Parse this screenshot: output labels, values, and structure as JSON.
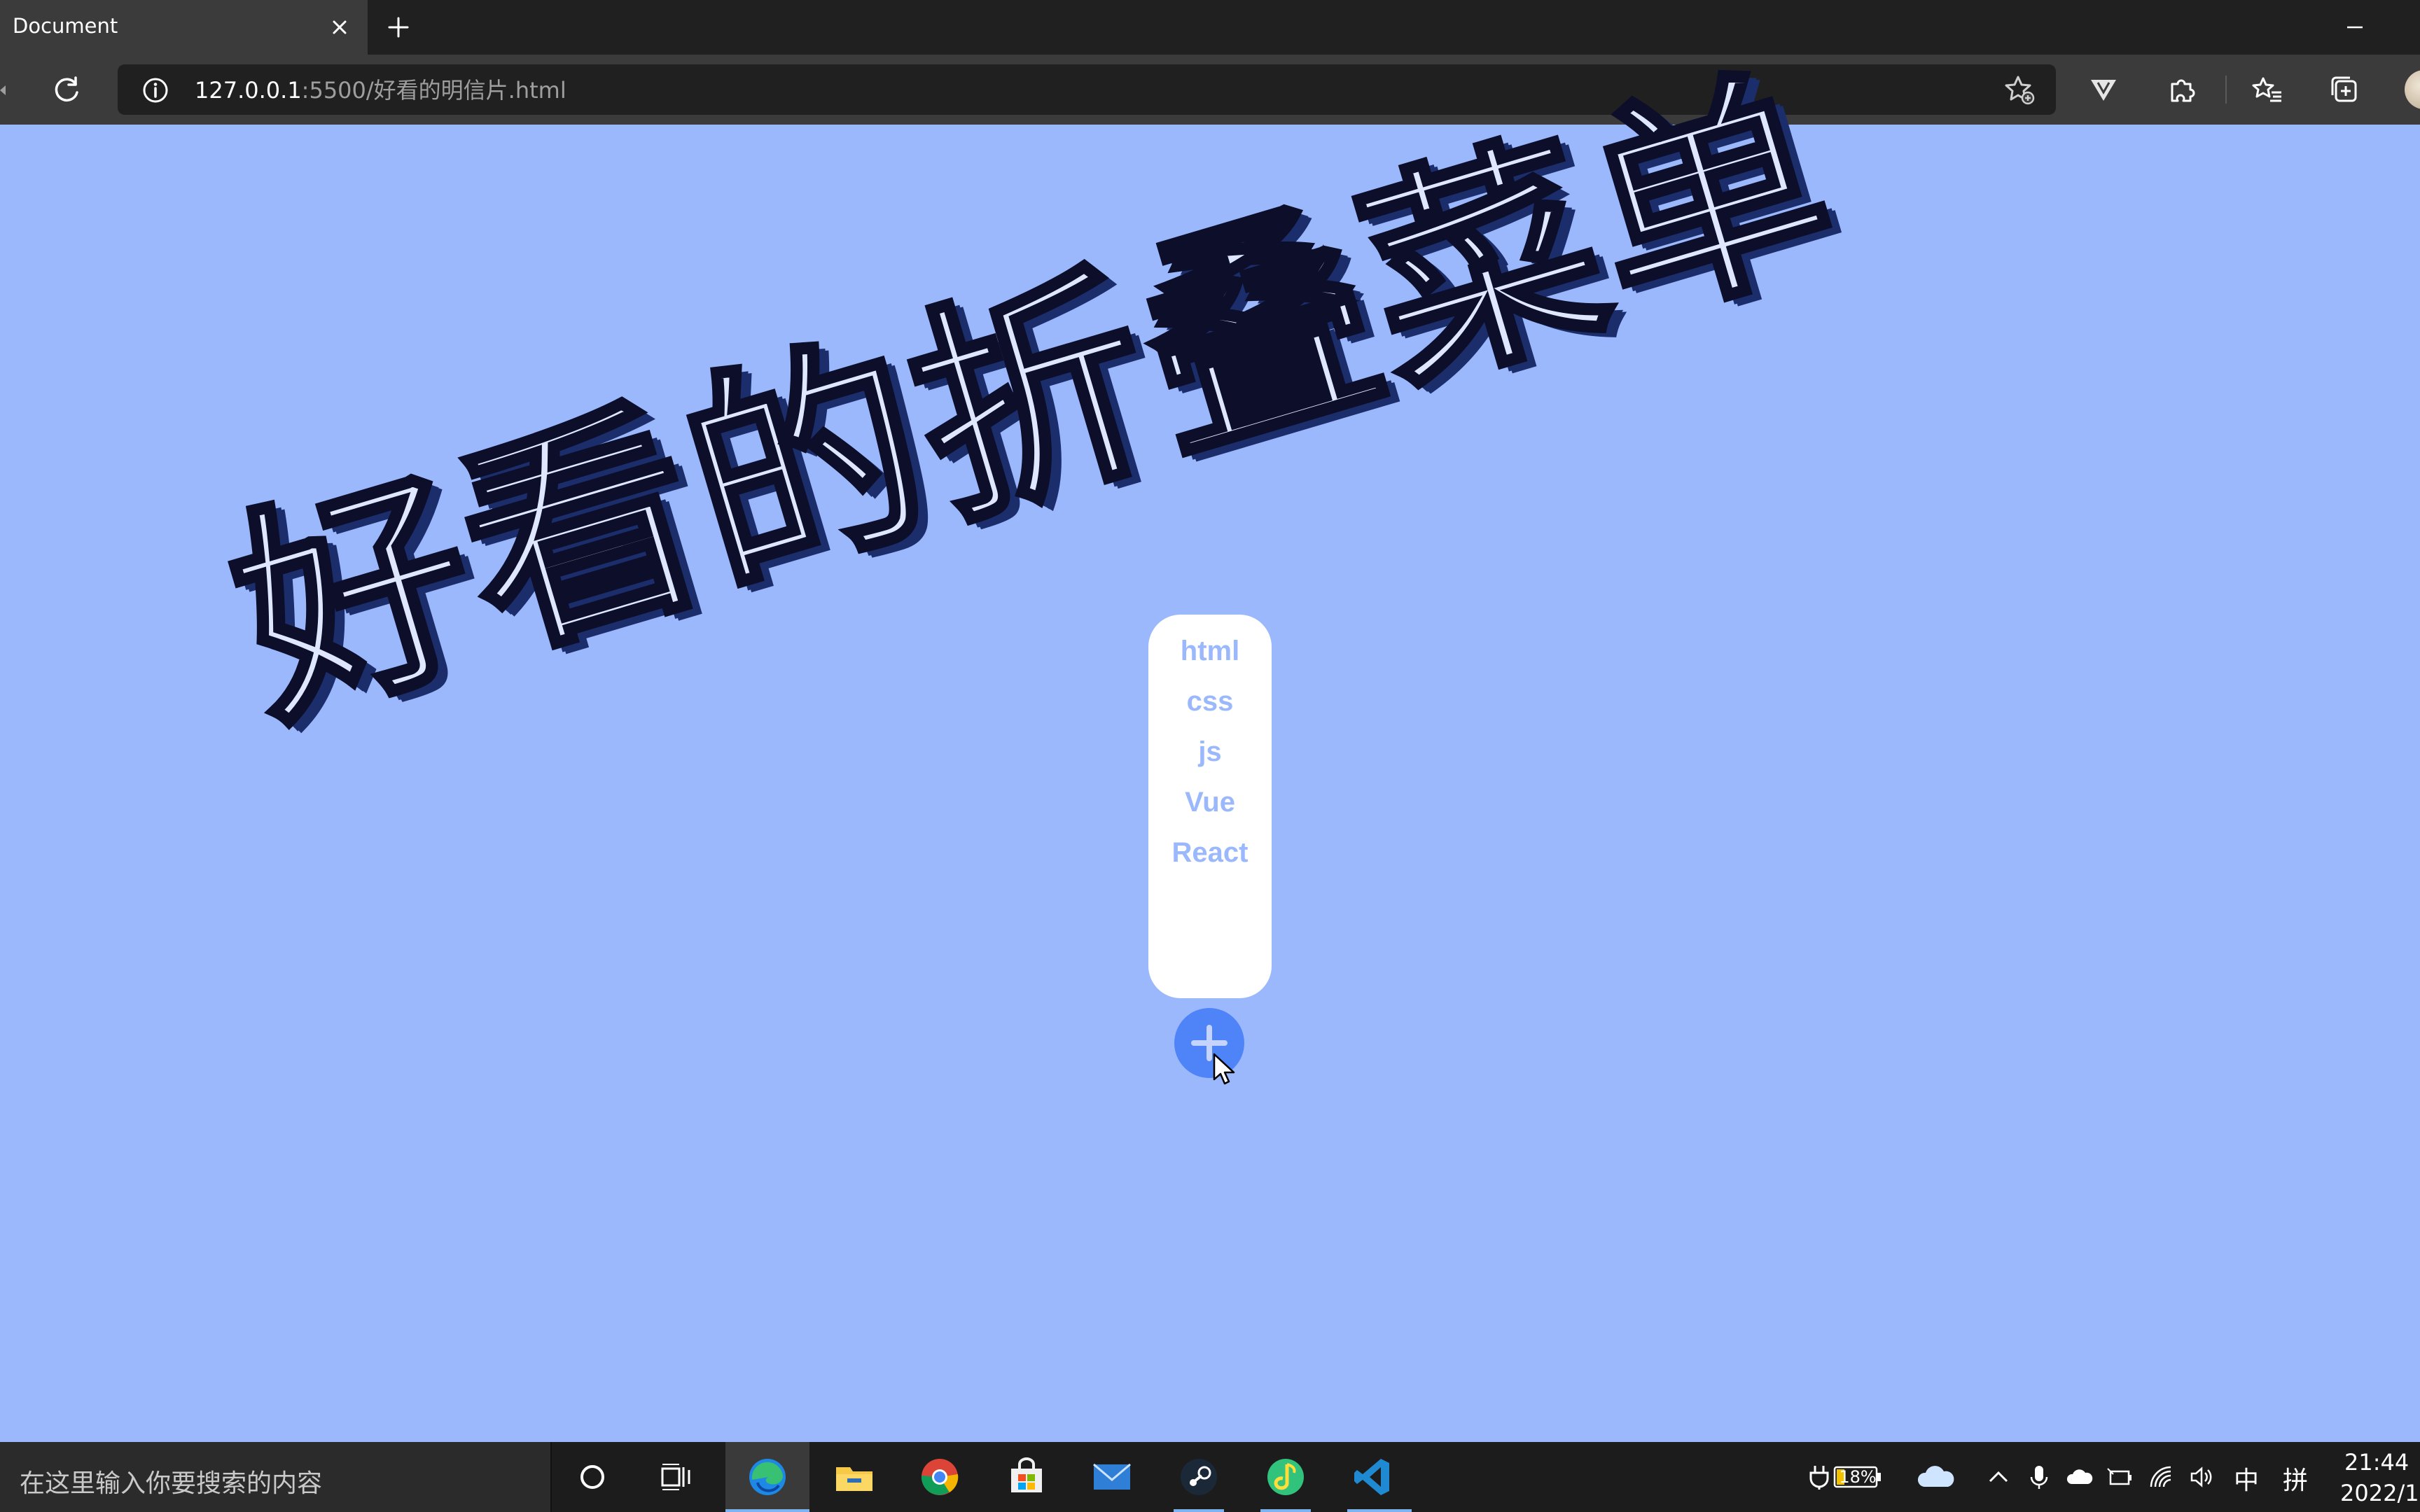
{
  "browser": {
    "tab_title": "Document",
    "url_host": "127.0.0.1",
    "url_rest": ":5500/好看的明信片.html"
  },
  "page": {
    "headline": "好看的折叠菜单",
    "menu_items": [
      "html",
      "css",
      "js",
      "Vue",
      "React"
    ],
    "fab_icon": "plus-icon",
    "colors": {
      "background": "#9bb8fd",
      "fab": "#4e84f8",
      "card": "#ffffff",
      "headline_fill": "#dfe7ff",
      "headline_shadow": "#1b2e6b"
    }
  },
  "taskbar": {
    "search_placeholder": "在这里输入你要搜索的内容",
    "battery": "18%",
    "ime_lang": "中",
    "ime_mode": "拼",
    "time": "21:44",
    "date": "2022/1"
  }
}
